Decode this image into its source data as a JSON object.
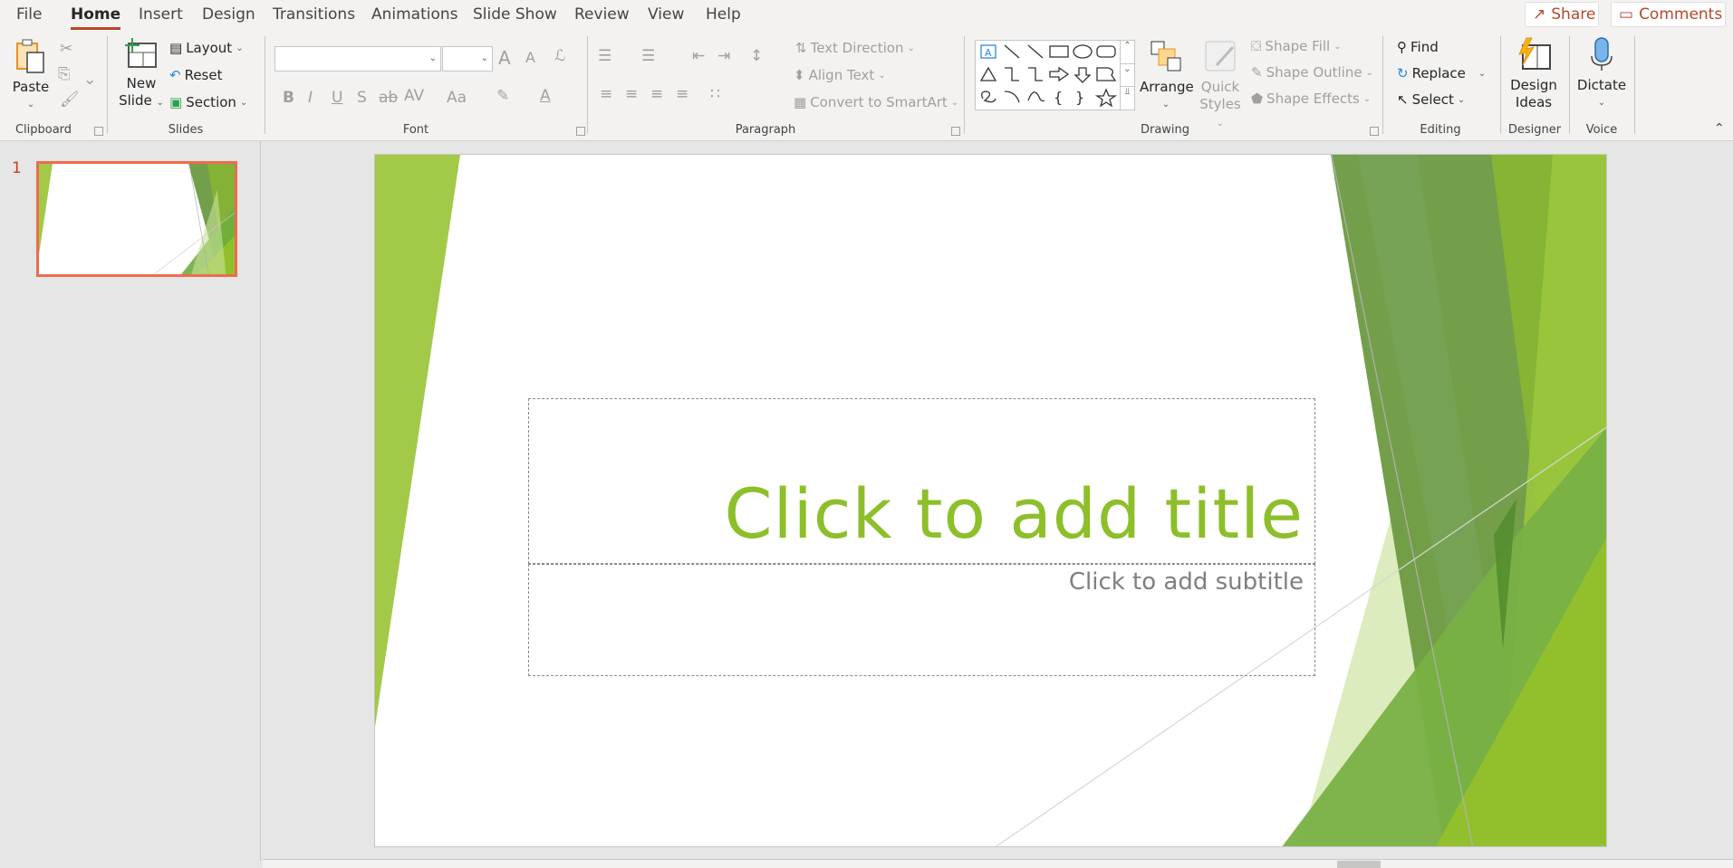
{
  "tabs": [
    {
      "label": "File"
    },
    {
      "label": "Home",
      "active": true
    },
    {
      "label": "Insert"
    },
    {
      "label": "Design"
    },
    {
      "label": "Transitions"
    },
    {
      "label": "Animations"
    },
    {
      "label": "Slide Show"
    },
    {
      "label": "Review"
    },
    {
      "label": "View"
    },
    {
      "label": "Help"
    }
  ],
  "top_buttons": {
    "share": "Share",
    "comments": "Comments"
  },
  "ribbon": {
    "clipboard": {
      "label": "Clipboard",
      "paste": "Paste"
    },
    "slides": {
      "label": "Slides",
      "new_slide_1": "New",
      "new_slide_2": "Slide",
      "layout": "Layout",
      "reset": "Reset",
      "section": "Section"
    },
    "font": {
      "label": "Font",
      "font_name": "",
      "font_size": "",
      "bold": "B",
      "italic": "I",
      "underline": "U",
      "shadow": "S",
      "strike": "ab",
      "spacing": "AV",
      "case": "Aa",
      "grow": "A",
      "shrink": "A"
    },
    "paragraph": {
      "label": "Paragraph",
      "text_direction": "Text Direction",
      "align_text": "Align Text",
      "convert_smartart": "Convert to SmartArt"
    },
    "drawing": {
      "label": "Drawing",
      "arrange": "Arrange",
      "quick_styles_1": "Quick",
      "quick_styles_2": "Styles",
      "shape_fill": "Shape Fill",
      "shape_outline": "Shape Outline",
      "shape_effects": "Shape Effects"
    },
    "editing": {
      "label": "Editing",
      "find": "Find",
      "replace": "Replace",
      "select": "Select"
    },
    "designer": {
      "label": "Designer",
      "design_ideas_1": "Design",
      "design_ideas_2": "Ideas"
    },
    "voice": {
      "label": "Voice",
      "dictate": "Dictate"
    }
  },
  "thumbnails": [
    {
      "number": "1",
      "selected": true
    }
  ],
  "slide": {
    "title_placeholder": "Click to add title",
    "subtitle_placeholder": "Click to add subtitle",
    "colors": {
      "title": "#8dbf2a",
      "subtitle": "#7f7f7f",
      "accent_light": "#a2c948",
      "accent_dark": "#6b9a40"
    }
  }
}
